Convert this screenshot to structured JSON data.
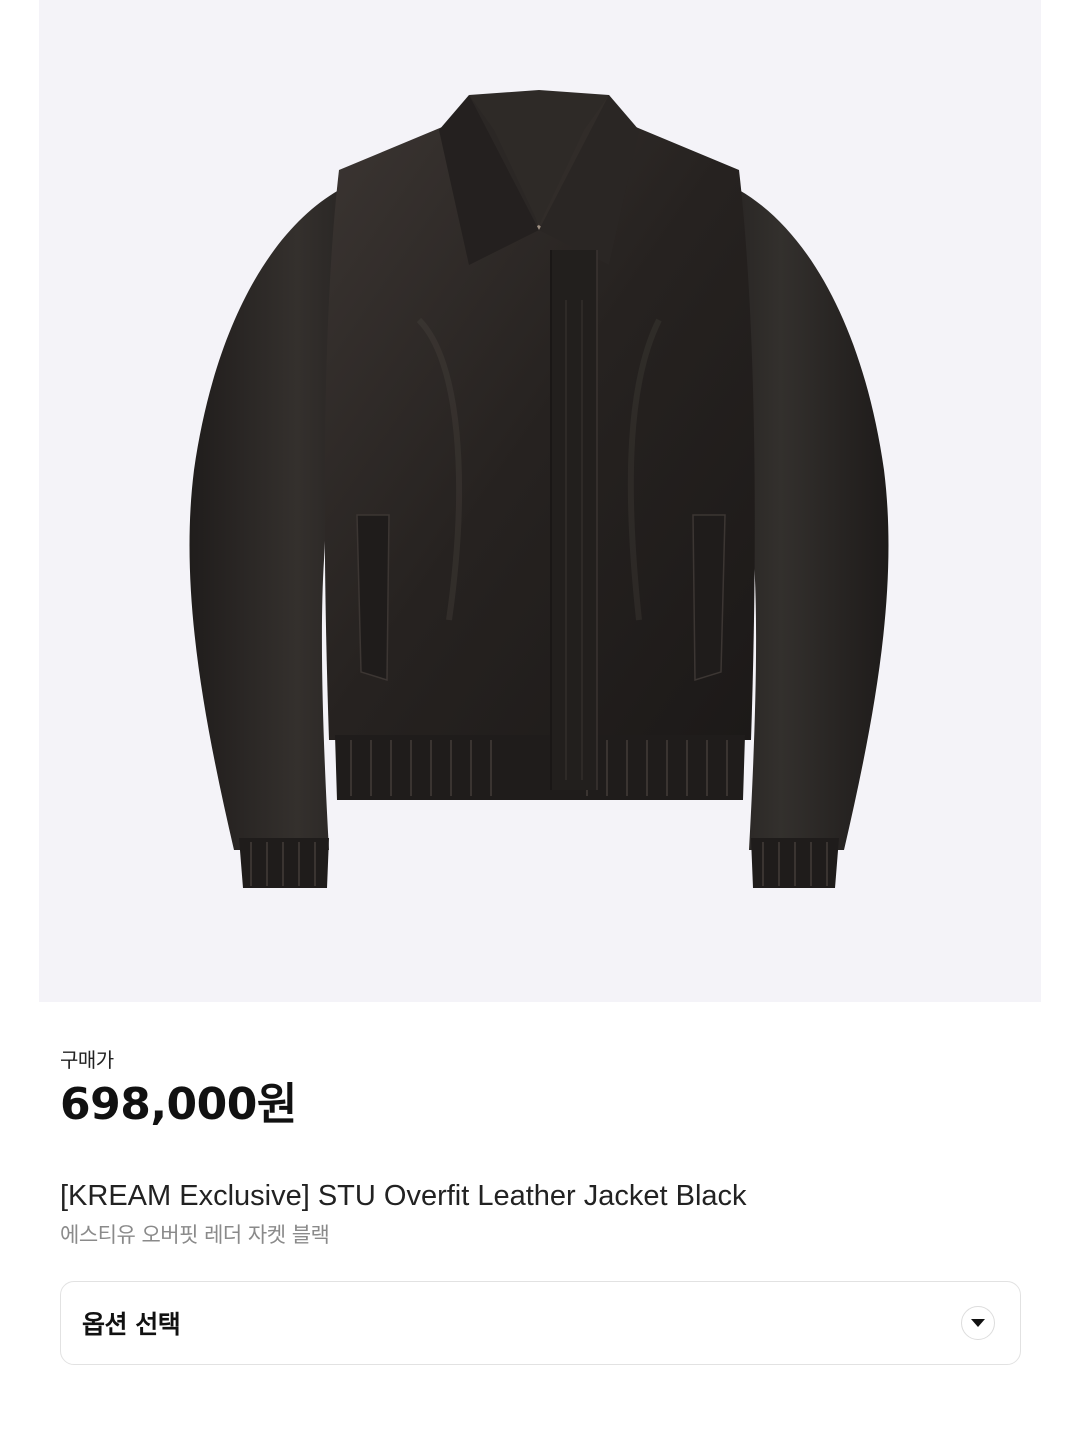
{
  "product": {
    "image_alt": "black oversized leather bomber jacket",
    "price_label": "구매가",
    "price": "698,000원",
    "title_en": "[KREAM Exclusive] STU Overfit Leather Jacket Black",
    "title_ko": "에스티유 오버핏 레더 자켓 블랙"
  },
  "option": {
    "label": "옵션 선택",
    "icon": "chevron-down-icon"
  },
  "colors": {
    "image_bg": "#f4f3f8",
    "leather": "#2a2624",
    "text_primary": "#111111",
    "text_secondary": "#8a8a8a",
    "border": "#e2e2e2"
  }
}
